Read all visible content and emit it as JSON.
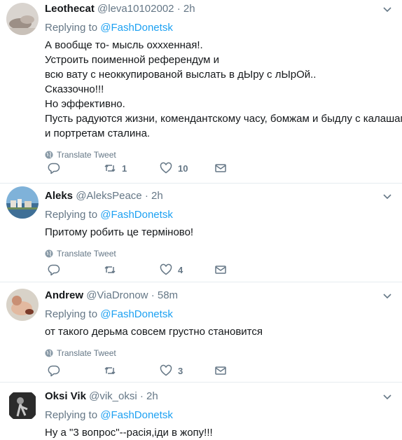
{
  "tweets": [
    {
      "name": "Leothecat",
      "handle": "@leva10102002",
      "time": "2h",
      "reply_prefix": "Replying to",
      "reply_to": "@FashDonetsk",
      "lines": [
        "А вообще то- мысль охххенная!.",
        "Устроить поименной референдум и",
        "всю вату с неоккупированой выслать в дЫру с лЫрОй..",
        "Сказзочно!!!",
        "Но эффективно.",
        "Пусть радуются жизни, комендантскому часу, бомжам и быдлу с калашами",
        "и портретам сталина."
      ],
      "translate": "Translate Tweet",
      "retweets": "1",
      "likes": "10"
    },
    {
      "name": "Aleks",
      "handle": "@AleksPeace",
      "time": "2h",
      "reply_prefix": "Replying to",
      "reply_to": "@FashDonetsk",
      "lines": [
        "Притому робить це терміново!"
      ],
      "translate": "Translate Tweet",
      "retweets": "",
      "likes": "4"
    },
    {
      "name": "Andrew",
      "handle": "@ViaDronow",
      "time": "58m",
      "reply_prefix": "Replying to",
      "reply_to": "@FashDonetsk",
      "lines": [
        "от такого дерьма совсем грустно становится"
      ],
      "translate": "Translate Tweet",
      "retweets": "",
      "likes": "3"
    },
    {
      "name": "Oksi Vik",
      "handle": "@vik_oksi",
      "time": "2h",
      "reply_prefix": "Replying to",
      "reply_to": "@FashDonetsk",
      "lines": [
        "Ну а \"3 вопрос\"--расія,іди в жопу!!!"
      ]
    }
  ],
  "separator": "·",
  "icons": {
    "reply": "reply-icon",
    "retweet": "retweet-icon",
    "like": "heart-icon",
    "dm": "envelope-icon",
    "globe": "globe-icon",
    "caret": "chevron-down-icon"
  },
  "colors": {
    "link": "#1da1f2",
    "muted": "#657786",
    "text": "#14171a",
    "border": "#e6ecf0"
  }
}
